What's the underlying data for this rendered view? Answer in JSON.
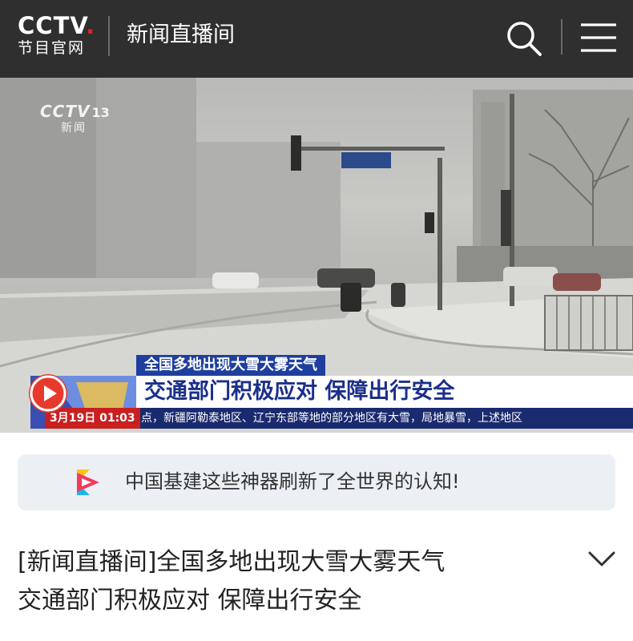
{
  "header": {
    "logo_main": "CCTV",
    "logo_dot": ".",
    "logo_sub": "节目官网",
    "title": "新闻直播间",
    "search_icon": "search-icon",
    "menu_icon": "menu-icon"
  },
  "video": {
    "watermark_main": "CCTV",
    "watermark_channel": "13",
    "watermark_sub": "新闻",
    "lower_third_top": "全国多地出现大雪大雾天气",
    "lower_third_main": "交通部门积极应对 保障出行安全",
    "date": "3月19日  01:03",
    "ticker": "点，新疆阿勒泰地区、辽宁东部等地的部分地区有大雪，局地暴雪，上述地区"
  },
  "promo": {
    "icon": "video-play-logo-icon",
    "text": "中国基建这些神器刷新了全世界的认知!"
  },
  "article": {
    "title_line1": "[新闻直播间]全国多地出现大雪大雾天气",
    "title_line2": "交通部门积极应对 保障出行安全",
    "expand_icon": "chevron-down-icon"
  },
  "colors": {
    "header_bg": "#2f2f2f",
    "accent_red": "#e2231a",
    "lower_third_blue": "#1f3f9e",
    "promo_bg": "#ecf0f5"
  }
}
